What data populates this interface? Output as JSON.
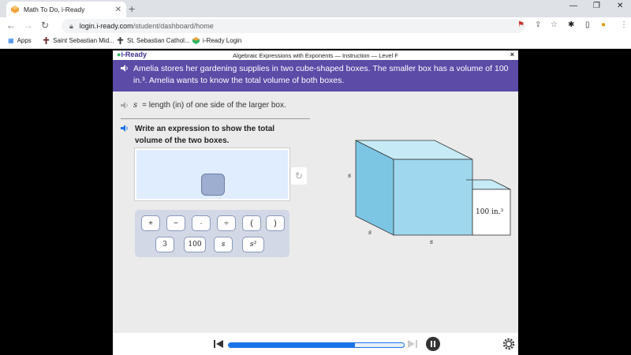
{
  "browser": {
    "tab_title": "Math To Do, i-Ready",
    "url_host": "login.i-ready.com",
    "url_path": "/student/dashboard/home",
    "bookmarks": [
      "Apps",
      "Saint Sebastian Mid...",
      "St. Sebastian Cathol...",
      "i-Ready Login"
    ]
  },
  "app": {
    "logo": "i-Ready",
    "title": "Algebraic Expressions with Exponents — Instruction — Level F",
    "close": "×",
    "problem_text": "Amelia stores her gardening supplies in two cube-shaped boxes. The smaller box has a volume of 100 in.³. Amelia wants to know the total volume of both boxes.",
    "variable": "s",
    "definition": "= length (in) of one side of the larger box.",
    "instruction": "Write an expression to show the total volume of the two boxes.",
    "keypad_row1": [
      "+",
      "−",
      "·",
      "÷",
      "(",
      ")"
    ],
    "keypad_row2": [
      "3",
      "100",
      "s",
      "s³"
    ],
    "figure": {
      "label_s_left": "s",
      "label_s_depth": "s",
      "label_s_bottom": "s",
      "small_volume": "100 in.³"
    },
    "progress_fraction": 0.72
  },
  "colors": {
    "banner": "#5c4ba7",
    "large_cube_front": "#9fd8ee",
    "large_cube_side": "#7cc6e4",
    "accent": "#1a73e8"
  }
}
